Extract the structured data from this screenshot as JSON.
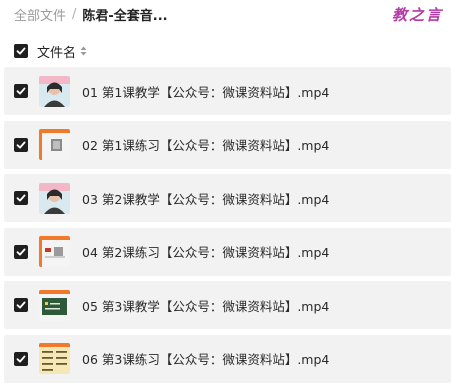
{
  "breadcrumb": {
    "root": "全部文件",
    "separator": "/",
    "current": "陈君-全套音..."
  },
  "watermark": "教之言",
  "list_header": {
    "column_label": "文件名",
    "select_all_checked": true,
    "sort_icon": "sort-updown-icon"
  },
  "files": [
    {
      "name": "01 第1课教学【公众号：微课资料站】.mp4",
      "checked": true,
      "thumb": "teacher-video-thumb"
    },
    {
      "name": "02 第1课练习【公众号：微课资料站】.mp4",
      "checked": true,
      "thumb": "practice-slide-thumb"
    },
    {
      "name": "03 第2课教学【公众号：微课资料站】.mp4",
      "checked": true,
      "thumb": "teacher-video-thumb"
    },
    {
      "name": "04 第2课练习【公众号：微课资料站】.mp4",
      "checked": true,
      "thumb": "practice-slide-thumb"
    },
    {
      "name": "05 第3课教学【公众号：微课资料站】.mp4",
      "checked": true,
      "thumb": "chalkboard-thumb"
    },
    {
      "name": "06 第3课练习【公众号：微课资料站】.mp4",
      "checked": true,
      "thumb": "worksheet-thumb"
    }
  ],
  "colors": {
    "row_background": "#f2f2f2",
    "checkbox": "#1f1f1f",
    "watermark": "#b43aa6",
    "breadcrumb_root": "#9a9a9a",
    "thumb_accent": "#f07a2a"
  }
}
